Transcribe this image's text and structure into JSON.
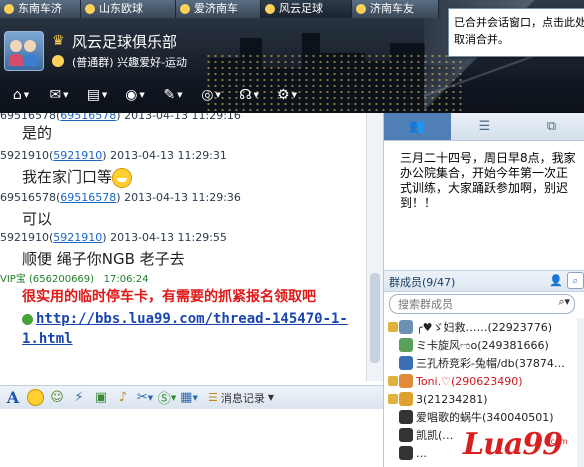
{
  "header": {
    "tabs": [
      {
        "label": "东南车济"
      },
      {
        "label": "山东欧球"
      },
      {
        "label": "爱济南车"
      },
      {
        "label": "风云足球"
      },
      {
        "label": "济南车友"
      }
    ],
    "group_name": "风云足球俱乐部",
    "group_type": "(普通群) 兴趣爱好-运动",
    "toolbar_icons": [
      "home-icon",
      "qzone-icon",
      "files-icon",
      "album-icon",
      "vote-icon",
      "app-icon",
      "notice-icon",
      "settings-icon"
    ]
  },
  "tooltip": {
    "text": "已合并会话窗口，点击此处取消合并。"
  },
  "chat": {
    "messages": [
      {
        "sender": "69516578",
        "qq": "69516578",
        "time": "2013-04-13 11:29:16",
        "text": "是的"
      },
      {
        "sender": "5921910",
        "qq": "5921910",
        "time": "2013-04-13 11:29:31",
        "text": "我在家门口等"
      },
      {
        "sender": "69516578",
        "qq": "69516578",
        "time": "2013-04-13 11:29:36",
        "text": "可以"
      },
      {
        "sender": "5921910",
        "qq": "5921910",
        "time": "2013-04-13 11:29:55",
        "text": "顺便 绳子你NGB 老子去"
      }
    ],
    "ad": {
      "sender": "VIP宝 (656200669)",
      "time": "17:06:24",
      "text": "很实用的临时停车卡，有需要的抓紧报名领取吧",
      "link": "http://bbs.lua99.com/thread-145470-1-1.html"
    }
  },
  "input_toolbar": {
    "history_label": "消息记录"
  },
  "right": {
    "notice": "三月二十四号，周日早8点，我家办公院集合，开始今年第一次正式训练，大家踊跃参加啊，别迟到！！",
    "members_title": "群成员(9/47)",
    "search_placeholder": "搜索群成员",
    "members": [
      {
        "name": "╭♥ゞ妇救……(22923776)",
        "red": false,
        "avatar": "#6b8fb5",
        "badge": "#e0b23b"
      },
      {
        "name": "ミ卡旋风ಌo(249381666)",
        "red": false,
        "avatar": "#5aa05a",
        "badge": ""
      },
      {
        "name": "三孔桥竞彩-兔帽/db(37874…",
        "red": false,
        "avatar": "#3b6fb5",
        "badge": ""
      },
      {
        "name": "Toni.♡(290623490)",
        "red": true,
        "avatar": "#e08a3a",
        "badge": "#e0b23b"
      },
      {
        "name": "3(21234281)",
        "red": false,
        "avatar": "#e0a030",
        "badge": "#e0b23b"
      },
      {
        "name": "爱唱歌的蜗牛(340040501)",
        "red": false,
        "avatar": "#333333",
        "badge": ""
      },
      {
        "name": "凯凯(…",
        "red": false,
        "avatar": "#333333",
        "badge": ""
      },
      {
        "name": "…",
        "red": false,
        "avatar": "#333333",
        "badge": ""
      }
    ]
  },
  "watermark": {
    "text": "Lua99",
    "sub": ".com"
  },
  "colors": {
    "ad_red": "#e01818",
    "link_blue": "#1a46b0",
    "qq_blue": "#1a66c6",
    "accent": "#4f7fb5"
  }
}
